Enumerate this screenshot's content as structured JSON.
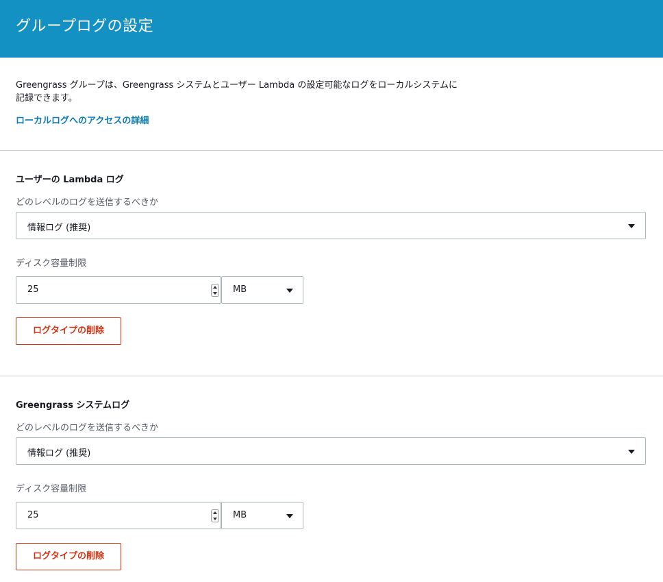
{
  "header": {
    "title": "グループログの設定"
  },
  "intro": {
    "description": "Greengrass グループは、Greengrass システムとユーザー Lambda の設定可能なログをローカルシステムに記録できます。",
    "link_label": "ローカルログへのアクセスの詳細"
  },
  "sections": [
    {
      "title": "ユーザーの Lambda ログ",
      "level_label": "どのレベルのログを送信するべきか",
      "level_value": "情報ログ (推奨)",
      "disk_label": "ディスク容量制限",
      "disk_value": "25",
      "disk_unit": "MB",
      "delete_label": "ログタイプの削除"
    },
    {
      "title": "Greengrass システムログ",
      "level_label": "どのレベルのログを送信するべきか",
      "level_value": "情報ログ (推奨)",
      "disk_label": "ディスク容量制限",
      "disk_value": "25",
      "disk_unit": "MB",
      "delete_label": "ログタイプの削除"
    }
  ],
  "colors": {
    "header_bg": "#1391c2",
    "link": "#0a7bb3",
    "danger": "#d13212"
  },
  "icons": {
    "select_caret": "caret-down-icon",
    "stepper": "spinner-updown-icon"
  }
}
